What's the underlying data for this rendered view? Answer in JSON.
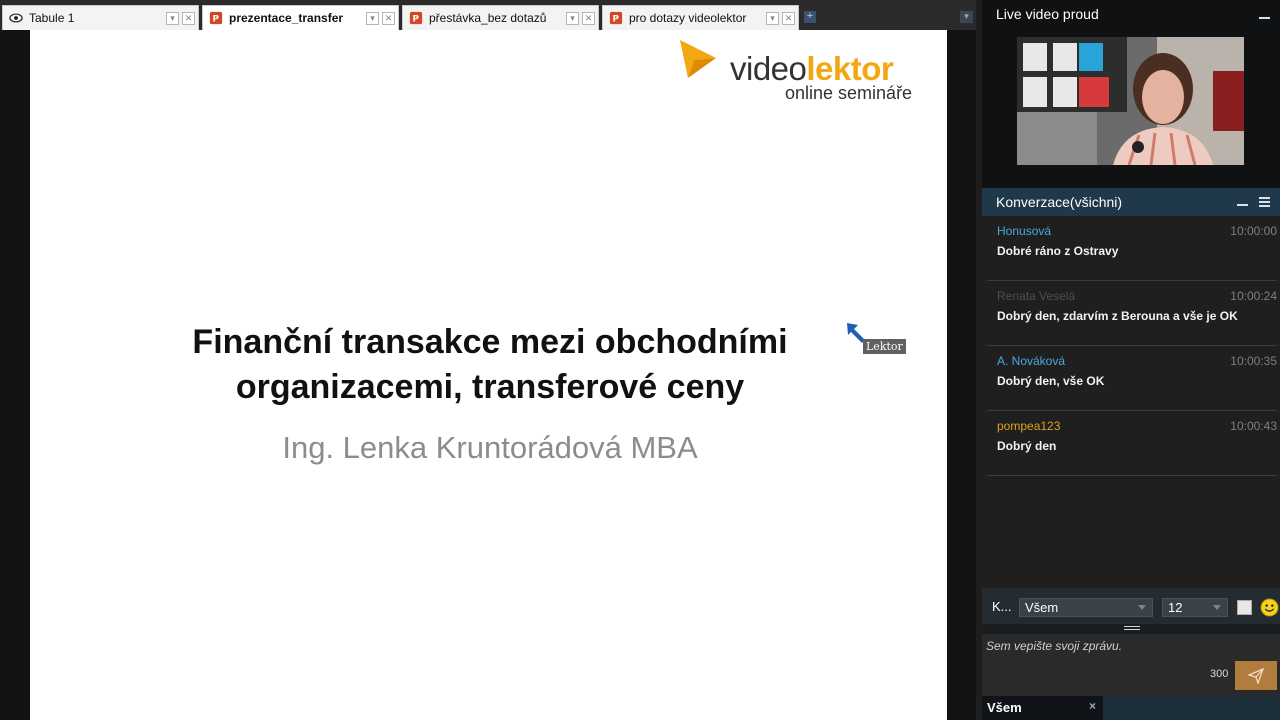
{
  "tabs": [
    {
      "label": "Tabule 1",
      "icon": "eye-icon",
      "active": false
    },
    {
      "label": "prezentace_transfer",
      "icon": "powerpoint-icon",
      "active": true
    },
    {
      "label": "přestávka_bez dotazů",
      "icon": "powerpoint-icon",
      "active": false
    },
    {
      "label": "pro dotazy videolektor",
      "icon": "powerpoint-icon",
      "active": false
    }
  ],
  "slide": {
    "logo_word_a": "video",
    "logo_word_b": "lektor",
    "logo_sub": "online semináře",
    "title_line1": "Finanční transakce mezi obchodními",
    "title_line2": "organizacemi, transferové ceny",
    "author": "Ing. Lenka Kruntorádová MBA",
    "cursor_label": "Lektor"
  },
  "video_panel": {
    "title": "Live video proud"
  },
  "conversation": {
    "title": "Konverzace(všichni)",
    "messages": [
      {
        "author": "Honusová",
        "time": "10:00:00",
        "text": "Dobré ráno z Ostravy",
        "color": "#4aa8e0"
      },
      {
        "author": "Renata Veselá",
        "time": "10:00:24",
        "text": "Dobrý den, zdarvím z Berouna a vše je OK",
        "color": "#4f4f4f"
      },
      {
        "author": "A. Nováková",
        "time": "10:00:35",
        "text": "Dobrý den, vše OK",
        "color": "#4aa8e0"
      },
      {
        "author": "pompea123",
        "time": "10:00:43",
        "text": "Dobrý den",
        "color": "#e0a020"
      }
    ]
  },
  "controls": {
    "k_label": "K...",
    "recipient": "Všem",
    "font_size": "12",
    "placeholder": "Sem vepište svoji zprávu.",
    "char_limit": "300"
  },
  "bottom_tab": {
    "label": "Všem",
    "close": "×"
  }
}
